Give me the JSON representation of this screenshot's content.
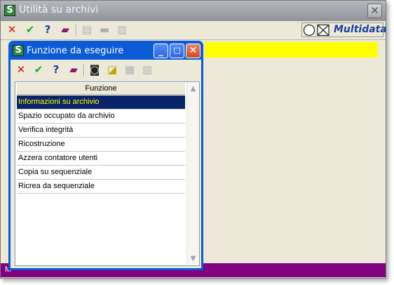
{
  "outer_window": {
    "title": "Utilità su archivi",
    "close_glyph": "✕",
    "toolbar": [
      {
        "icon": "cancel-icon",
        "glyph": "✕",
        "color": "#e01010"
      },
      {
        "icon": "confirm-icon",
        "glyph": "✔",
        "color": "#28a028"
      },
      {
        "icon": "help-icon",
        "glyph": "?",
        "color": "#1a3fa0"
      },
      {
        "icon": "book-icon",
        "glyph": "▰",
        "color": "#8b1a6b"
      },
      {
        "icon": "page-icon",
        "glyph": "▤",
        "color": "#b0b0b0"
      },
      {
        "icon": "folder-icon",
        "glyph": "▬",
        "color": "#b0b0b0"
      },
      {
        "icon": "list-icon",
        "glyph": "▥",
        "color": "#b0b0b0"
      }
    ],
    "brand": "Multidata",
    "status_text": "M"
  },
  "dialog": {
    "title": "Funzione da eseguire",
    "min_glyph": "_",
    "max_glyph": "□",
    "close_glyph": "✕",
    "toolbar": [
      {
        "icon": "cancel-icon",
        "glyph": "✕",
        "color": "#e01010"
      },
      {
        "icon": "confirm-icon",
        "glyph": "✔",
        "color": "#28a028"
      },
      {
        "icon": "help-icon",
        "glyph": "?",
        "color": "#1a3fa0"
      },
      {
        "icon": "book-icon",
        "glyph": "▰",
        "color": "#8b1a6b"
      },
      {
        "icon": "binoculars-icon",
        "glyph": "◙",
        "color": "#222222"
      },
      {
        "icon": "ruler-icon",
        "glyph": "◪",
        "color": "#c8a000"
      },
      {
        "icon": "grid-icon",
        "glyph": "▦",
        "color": "#b0b0b0"
      },
      {
        "icon": "copy-icon",
        "glyph": "▥",
        "color": "#b0b0b0"
      }
    ],
    "column_header": "Funzione",
    "rows": [
      "Informazioni su archivio",
      "Spazio occupato da archivio",
      "Verifica integrità",
      "Ricostruzione",
      "Azzera contatore utenti",
      "Copia su sequenziale",
      "Ricrea da sequenziale"
    ],
    "selected_index": 0,
    "scroll_up": "▲",
    "scroll_down": "▼"
  },
  "colors": {
    "selection_bg": "#0a246a",
    "selection_text": "#ffff00",
    "highlight_bar": "#ffff00",
    "status_bar": "#800080",
    "dialog_frame": "#0a5bd5"
  }
}
